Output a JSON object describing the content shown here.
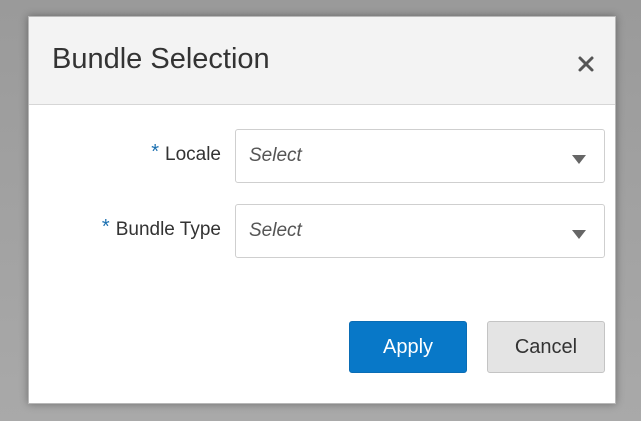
{
  "dialog": {
    "title": "Bundle Selection",
    "close_icon": "close-icon"
  },
  "form": {
    "required_marker": "*",
    "locale": {
      "label": "Locale",
      "value": "Select"
    },
    "bundle_type": {
      "label": "Bundle Type",
      "value": "Select"
    }
  },
  "buttons": {
    "apply_label": "Apply",
    "cancel_label": "Cancel"
  },
  "colors": {
    "accent": "#0878c8",
    "required": "#1a6fb0"
  }
}
